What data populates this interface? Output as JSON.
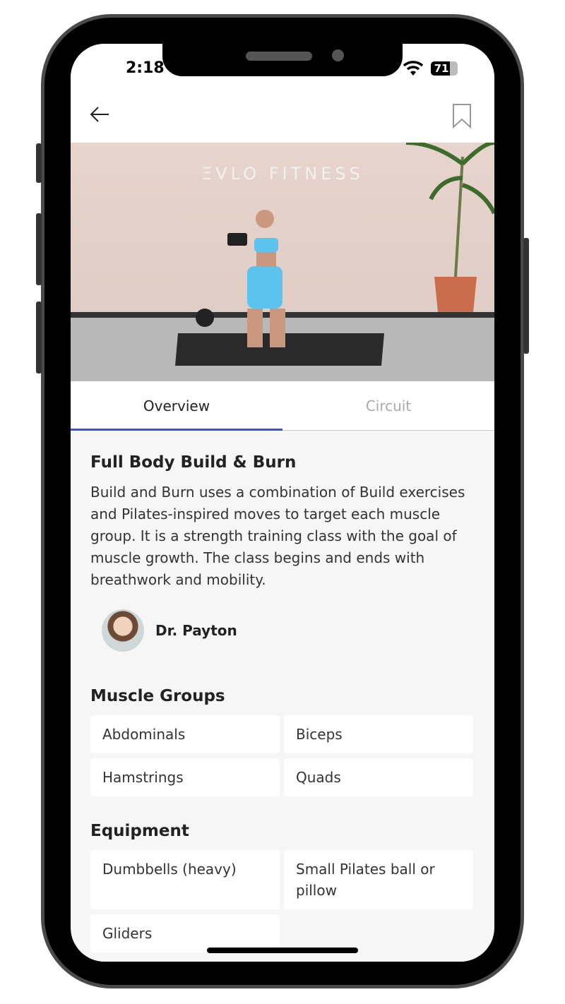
{
  "status": {
    "time": "2:18",
    "battery": "71",
    "battery_level": 0.71
  },
  "header": {
    "back_icon": "arrow-left-icon",
    "bookmark_icon": "bookmark-icon"
  },
  "hero": {
    "logo": "ΞVLO FITNESS"
  },
  "tabs": [
    {
      "label": "Overview",
      "active": true
    },
    {
      "label": "Circuit",
      "active": false
    }
  ],
  "workout": {
    "title": "Full Body Build & Burn",
    "description": "Build and Burn uses a combination of Build exercises and Pilates-inspired moves to target each muscle group. It is a strength training class with the goal of muscle growth. The class begins and ends with breathwork and mobility.",
    "instructor": "Dr. Payton"
  },
  "muscle_groups": {
    "title": "Muscle Groups",
    "items": [
      "Abdominals",
      "Biceps",
      "Hamstrings",
      "Quads"
    ]
  },
  "equipment": {
    "title": "Equipment",
    "items": [
      "Dumbbells (heavy)",
      "Small Pilates ball or pillow",
      "Gliders"
    ]
  },
  "colors": {
    "accent": "#3d4ee8",
    "background": "#f6f6f6"
  }
}
